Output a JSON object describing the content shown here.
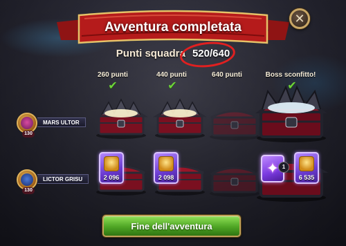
{
  "header": {
    "title": "Avventura completata",
    "close_icon": "close-icon"
  },
  "score": {
    "label": "Punti squadra",
    "value": "520/640"
  },
  "thresholds": [
    {
      "label": "260 punti",
      "achieved": true
    },
    {
      "label": "440 punti",
      "achieved": true
    },
    {
      "label": "640 punti",
      "achieved": false
    },
    {
      "label": "Boss sconfitto!",
      "achieved": true
    }
  ],
  "players": [
    {
      "name": "MARS ULTOR",
      "level": "130",
      "chests": [
        {
          "state": "opened"
        },
        {
          "state": "opened"
        },
        {
          "state": "locked"
        },
        {
          "state": "opened"
        }
      ]
    },
    {
      "name": "LICTOR GRISU",
      "level": "130",
      "rewards": [
        {
          "qty": "2 096",
          "icon": "gold-coins-icon"
        },
        {
          "qty": "2 098",
          "icon": "gold-coins-icon"
        },
        {
          "qty": "",
          "icon": "chest-locked-icon"
        },
        {
          "qty": "6 535",
          "icon": "gold-coins-icon",
          "extra": {
            "icon": "star-icon",
            "count": "1"
          }
        }
      ]
    }
  ],
  "footer": {
    "finish_label": "Fine dell'avventura"
  },
  "colors": {
    "ribbon_red": "#b51b1b",
    "check_green": "#6ed43a",
    "button_green": "#4ea524",
    "reward_purple": "#6a3ad0",
    "highlight_ring": "#e02020"
  }
}
